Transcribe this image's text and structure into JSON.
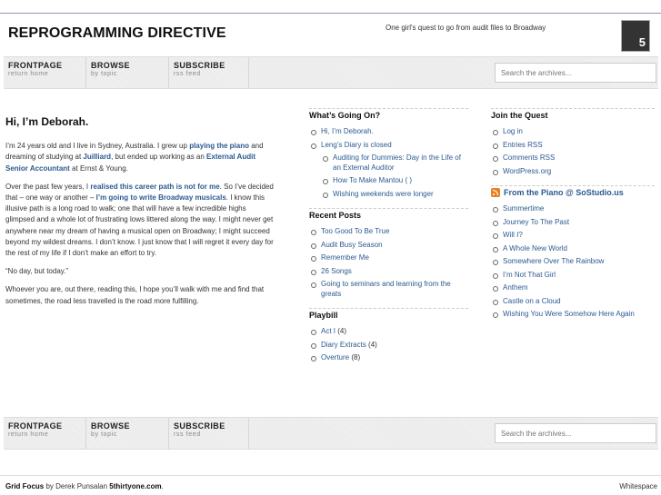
{
  "header": {
    "title": "REPROGRAMMING DIRECTIVE",
    "tagline": "One girl's quest to go from audit files to Broadway",
    "calendar_day": "5"
  },
  "nav": {
    "items": [
      {
        "label": "FRONTPAGE",
        "sub": "return home"
      },
      {
        "label": "BROWSE",
        "sub": "by topic"
      },
      {
        "label": "SUBSCRIBE",
        "sub": "rss feed"
      }
    ],
    "search_placeholder": "Search the archives..."
  },
  "post": {
    "title": "Hi, I’m Deborah.",
    "p1": [
      "I’m 24 years old and I live in Sydney, Australia. I grew up ",
      "playing the piano",
      " and dreaming of studying at ",
      "Juilliard",
      ", but ended up working as an ",
      "External Audit Senior Accountant",
      " at Ernst & Young."
    ],
    "p2": [
      "Over the past few years, I ",
      "realised this career path is not for me",
      ". So I’ve decided that – one way or another – ",
      "I’m going to write Broadway musicals",
      ". I know this illusive path is a long road to walk; one that will have a few incredible highs glimpsed and a whole lot of frustrating lows littered along the way. I might never get anywhere near my dream of having a musical open on Broadway; I might succeed beyond my wildest dreams. I don’t know. I just know that I will regret it every day for the rest of my life if I don’t make an effort to try."
    ],
    "p3": "“No day, but today.”",
    "p4": "Whoever you are, out there, reading this, I hope you’ll walk with me and find that sometimes, the road less travelled is the road more fulfilling."
  },
  "sidebar1": {
    "whats_going_on": {
      "title": "What’s Going On?",
      "items": [
        "Hi, I’m Deborah.",
        "Leng’s Diary is closed"
      ],
      "sub_items": [
        "Auditing for Dummies: Day in the Life of an External Auditor",
        "How To Make Mantou (  )",
        "Wishing weekends were longer"
      ]
    },
    "recent_posts": {
      "title": "Recent Posts",
      "items": [
        "Too Good To Be True",
        "Audit Busy Season",
        "Remember Me",
        "26 Songs",
        "Going to seminars and learning from the greats"
      ]
    },
    "playbill": {
      "title": "Playbill",
      "items": [
        {
          "name": "Act I",
          "count": "(4)"
        },
        {
          "name": "Diary Extracts",
          "count": "(4)"
        },
        {
          "name": "Overture",
          "count": "(8)"
        }
      ]
    }
  },
  "sidebar2": {
    "join": {
      "title": "Join the Quest",
      "items": [
        "Log in",
        "Entries RSS",
        "Comments RSS",
        "WordPress.org"
      ]
    },
    "feed": {
      "title": "From the Piano @ SoStudio.us",
      "items": [
        "Summertime",
        "Journey To The Past",
        "Will I?",
        "A Whole New World",
        "Somewhere Over The Rainbow",
        "I’m Not That Girl",
        "Anthem",
        "Castle on a Cloud",
        "Wishing You Were Somehow Here Again"
      ]
    }
  },
  "footer": {
    "theme": "Grid Focus",
    "by": " by Derek Punsalan ",
    "site": "5thirtyone.com",
    "period": ".",
    "right": "Whitespace"
  }
}
